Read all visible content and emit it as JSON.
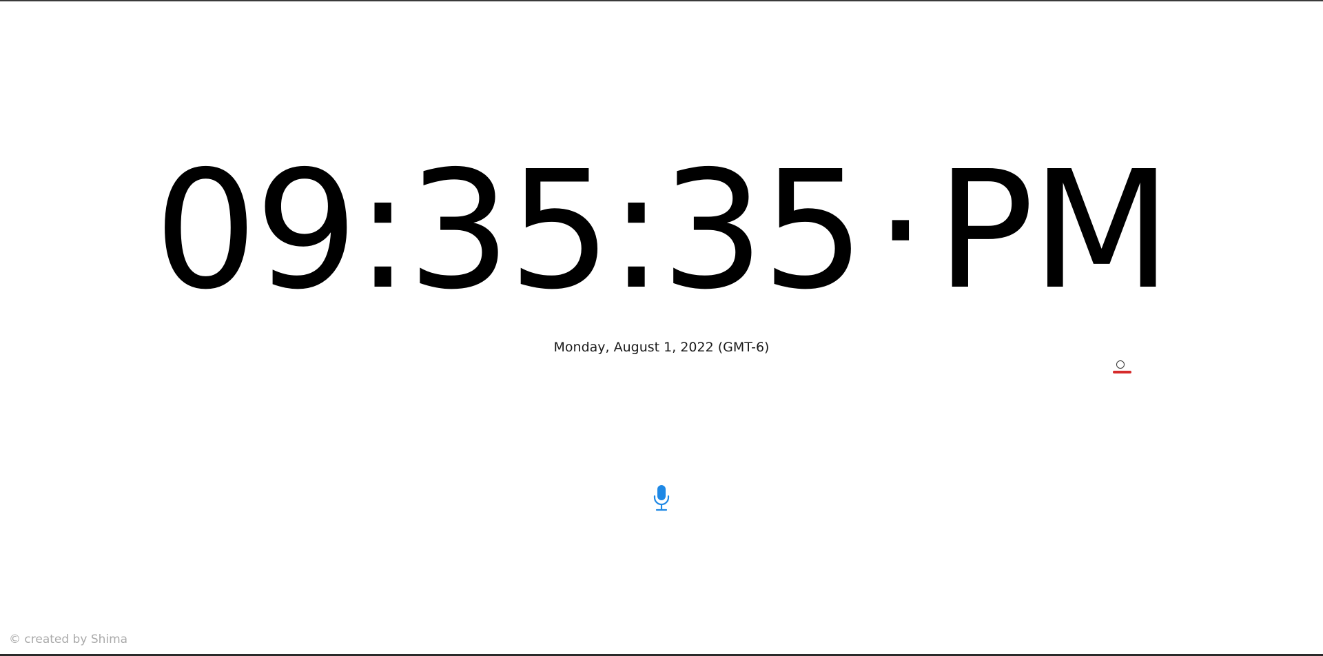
{
  "clock": {
    "hours": "09",
    "minutes": "35",
    "seconds": "35",
    "separator": ":",
    "period_dot": "·",
    "period": "PM"
  },
  "date_line": "Monday, August 1, 2022 (GMT-6)",
  "footer": {
    "credit": "© created by Shima"
  },
  "icons": {
    "alarm": "alarm-icon",
    "microphone": "microphone-icon"
  },
  "colors": {
    "background": "#ffffff",
    "clock_text": "#000000",
    "alarm_accent": "#d62b2b",
    "microphone": "#1e88e5",
    "footer_text": "#a9a9a9"
  }
}
